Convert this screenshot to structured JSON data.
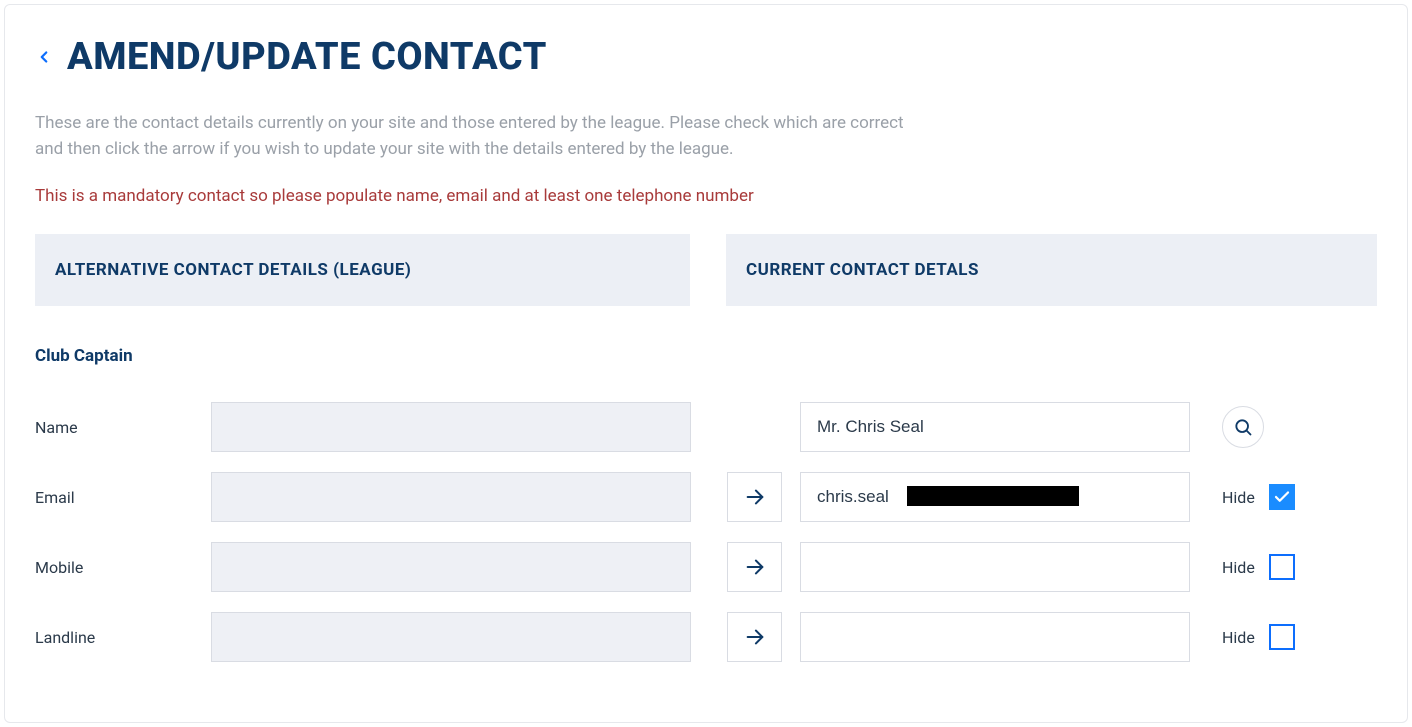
{
  "header": {
    "title": "AMEND/UPDATE CONTACT"
  },
  "intro": "These are the contact details currently on your site and those entered by the league. Please check which are correct and then click the arrow if you wish to update your site with the details entered by the league.",
  "mandatory_note": "This is a mandatory contact so please populate name, email and at least one telephone number",
  "sections": {
    "alternative_header": "ALTERNATIVE CONTACT DETAILS (LEAGUE)",
    "current_header": "CURRENT CONTACT DETALS"
  },
  "role_title": "Club Captain",
  "fields": {
    "name": {
      "label": "Name",
      "league_value": "",
      "current_value": "Mr. Chris Seal"
    },
    "email": {
      "label": "Email",
      "league_value": "",
      "current_value": "chris.seal",
      "hide_label": "Hide",
      "hide_checked": true
    },
    "mobile": {
      "label": "Mobile",
      "league_value": "",
      "current_value": "",
      "hide_label": "Hide",
      "hide_checked": false
    },
    "landline": {
      "label": "Landline",
      "league_value": "",
      "current_value": "",
      "hide_label": "Hide",
      "hide_checked": false
    }
  }
}
